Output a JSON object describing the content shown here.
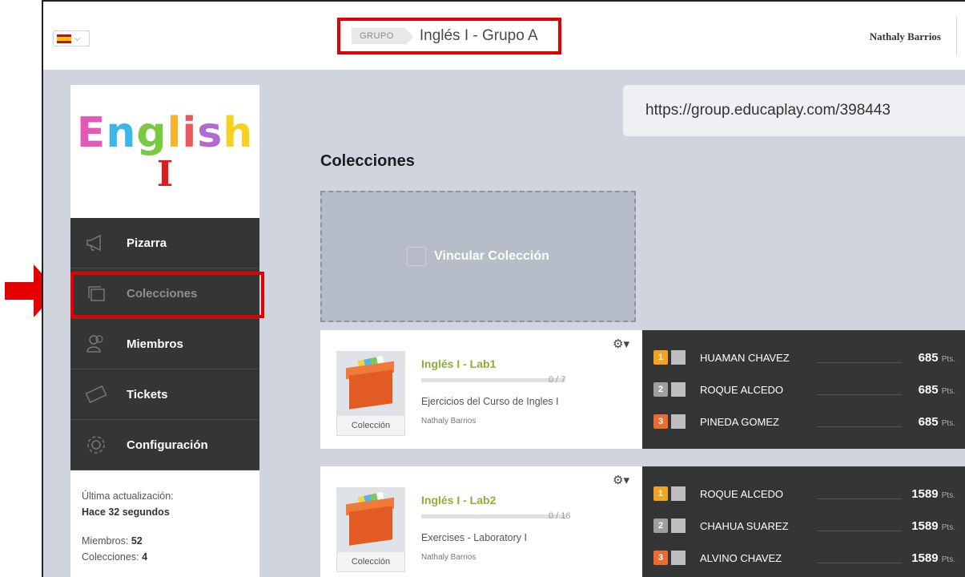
{
  "topbar": {
    "group_badge": "GRUPO",
    "group_title": "Inglés I - Grupo A",
    "user_name": "Nathaly Barrios"
  },
  "sidebar": {
    "logo_word": [
      "E",
      "n",
      "g",
      "l",
      "i",
      "s",
      "h"
    ],
    "logo_subtitle": "I",
    "items": [
      {
        "label": "Pizarra",
        "icon": "megaphone-icon"
      },
      {
        "label": "Colecciones",
        "icon": "collections-icon"
      },
      {
        "label": "Miembros",
        "icon": "members-icon"
      },
      {
        "label": "Tickets",
        "icon": "ticket-icon"
      },
      {
        "label": "Configuración",
        "icon": "gear-icon"
      }
    ],
    "info": {
      "last_update_label": "Última actualización:",
      "last_update_value": "Hace 32 segundos",
      "members_label": "Miembros:",
      "members_value": "52",
      "collections_label": "Colecciones:",
      "collections_value": "4"
    }
  },
  "main": {
    "group_url": "https://group.educaplay.com/398443",
    "section_title": "Colecciones",
    "link_collection_label": "Vincular Colección",
    "collections": [
      {
        "title": "Inglés I - Lab1",
        "count": "0 / 7",
        "description": "Ejercicios del Curso de Ingles I",
        "author": "Nathaly Barrios",
        "thumb_label": "Colección",
        "ranking": [
          {
            "pos": "1",
            "name": "HUAMAN CHAVEZ",
            "points": "685",
            "unit": "Pts."
          },
          {
            "pos": "2",
            "name": "ROQUE ALCEDO",
            "points": "685",
            "unit": "Pts."
          },
          {
            "pos": "3",
            "name": "PINEDA GOMEZ",
            "points": "685",
            "unit": "Pts."
          }
        ]
      },
      {
        "title": "Inglés I - Lab2",
        "count": "0 / 16",
        "description": "Exercises - Laboratory I",
        "author": "Nathaly Barrios",
        "thumb_label": "Colección",
        "ranking": [
          {
            "pos": "1",
            "name": "ROQUE ALCEDO",
            "points": "1589",
            "unit": "Pts."
          },
          {
            "pos": "2",
            "name": "CHAHUA SUAREZ",
            "points": "1589",
            "unit": "Pts."
          },
          {
            "pos": "3",
            "name": "ALVINO CHAVEZ",
            "points": "1589",
            "unit": "Pts."
          }
        ]
      }
    ]
  },
  "colors": {
    "highlight_red": "#e40000",
    "sidebar_dark": "#333537",
    "collection_title_green": "#8cb035",
    "gold": "#f5a21e",
    "silver": "#9e9e9e",
    "bronze": "#ee6b2f"
  }
}
